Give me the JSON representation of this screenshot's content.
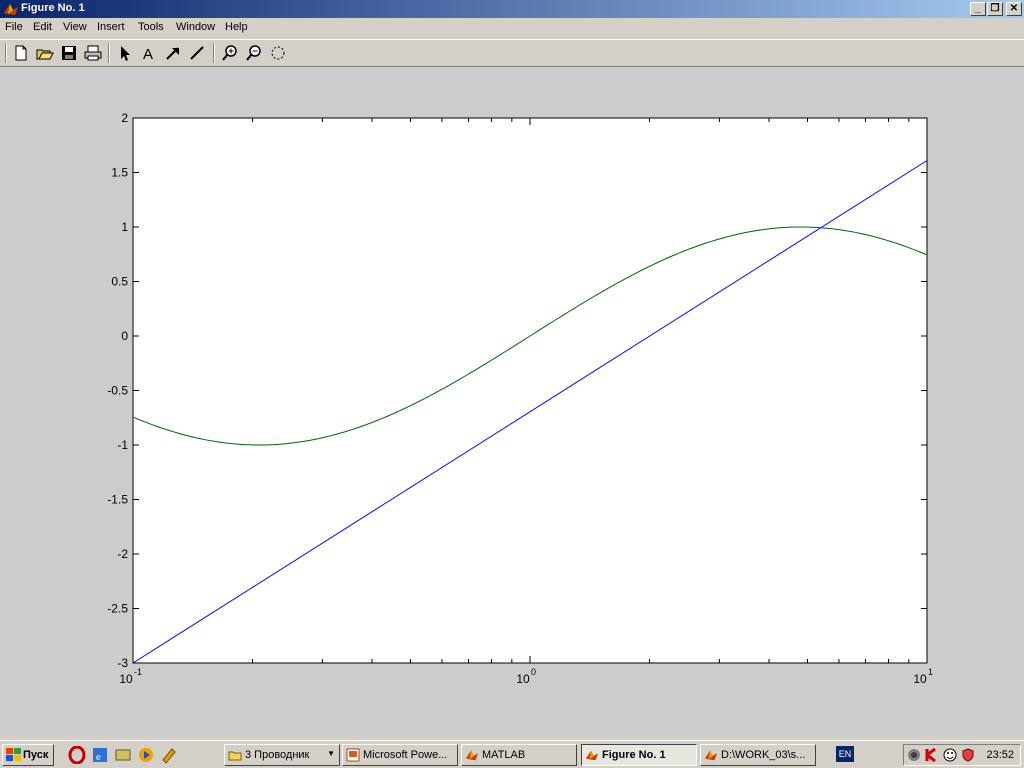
{
  "window": {
    "title": "Figure No. 1",
    "minimize": "_",
    "restore": "❐",
    "close": "✕"
  },
  "menu": [
    "File",
    "Edit",
    "View",
    "Insert",
    "Tools",
    "Window",
    "Help"
  ],
  "toolbar": {
    "icons": [
      "new-file-icon",
      "open-file-icon",
      "save-icon",
      "print-icon",
      "select-arrow-icon",
      "insert-text-icon",
      "insert-arrow-icon",
      "insert-line-icon",
      "zoom-in-icon",
      "zoom-out-icon",
      "rotate-3d-icon"
    ],
    "text_tool_glyph": "A"
  },
  "chart_data": {
    "type": "line",
    "xscale": "log",
    "xlim": [
      0.1,
      10
    ],
    "ylim": [
      -3,
      2
    ],
    "yticks": [
      -3,
      -2.5,
      -2,
      -1.5,
      -1,
      -0.5,
      0,
      0.5,
      1,
      1.5,
      2
    ],
    "ytick_labels": [
      "-3",
      "-2.5",
      "-2",
      "-1.5",
      "-1",
      "-0.5",
      "0",
      "0.5",
      "1",
      "1.5",
      "2"
    ],
    "xticks": [
      0.1,
      1,
      10
    ],
    "xtick_labels": [
      {
        "base": "10",
        "exp": "-1"
      },
      {
        "base": "10",
        "exp": "0"
      },
      {
        "base": "10",
        "exp": "1"
      }
    ],
    "grid": false,
    "series": [
      {
        "color": "#0000ff",
        "x": [
          0.1,
          10
        ],
        "y": [
          -3,
          1.61
        ]
      },
      {
        "color": "#006400",
        "formula": "sin(ln(x))",
        "samples": 200
      }
    ]
  },
  "taskbar": {
    "start_label": "Пуск",
    "tasks": [
      {
        "label": "3 Проводник",
        "icon": "folder-icon",
        "has_arrow": true
      },
      {
        "label": "Microsoft Powe...",
        "icon": "powerpoint-icon"
      },
      {
        "label": "MATLAB",
        "icon": "matlab-icon"
      },
      {
        "label": "Figure No. 1",
        "icon": "matlab-icon",
        "active": true
      },
      {
        "label": "D:\\WORK_03\\s...",
        "icon": "matlab-icon"
      }
    ],
    "lang": "EN",
    "clock": "23:52"
  }
}
